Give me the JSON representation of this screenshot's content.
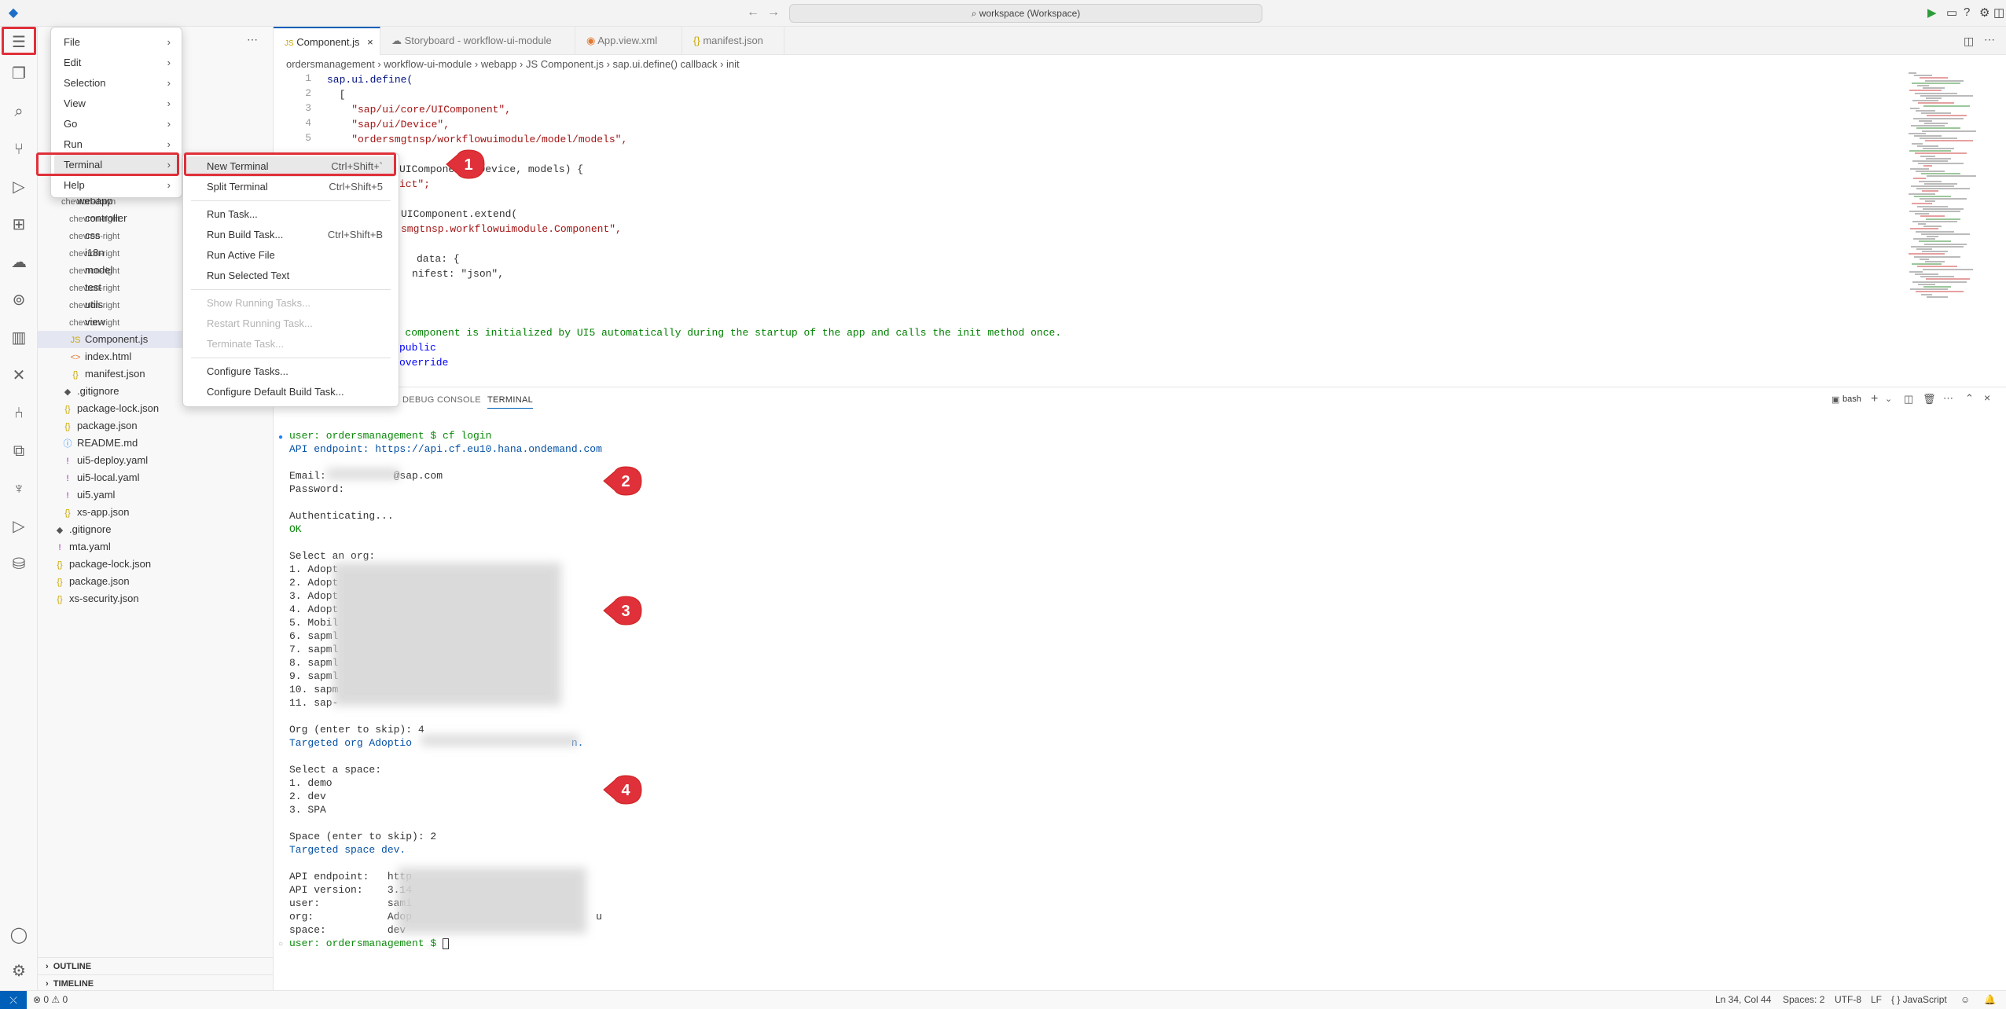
{
  "titlebar": {
    "command_center": "workspace (Workspace)",
    "back_icon": "arrow-left-icon",
    "forward_icon": "arrow-right-icon"
  },
  "activity_icons": [
    "menu-icon",
    "explorer-icon",
    "search-icon",
    "source-control-icon",
    "run-debug-icon",
    "extensions-icon",
    "cloud-icon",
    "git-graph-icon",
    "library-icon",
    "tools-icon",
    "branch-icon",
    "code-icon",
    "tree-icon",
    "play-icon",
    "database-icon",
    "account-icon",
    "settings-icon"
  ],
  "tabs": [
    {
      "label": "Component.js",
      "active": true,
      "icon": "js-icon"
    },
    {
      "label": "Storyboard - workflow-ui-module",
      "active": false,
      "icon": "storyboard-icon"
    },
    {
      "label": "App.view.xml",
      "active": false,
      "icon": "rss-icon"
    },
    {
      "label": "manifest.json",
      "active": false,
      "icon": "json-icon"
    }
  ],
  "breadcrumb": [
    "ordersmanagement",
    "workflow-ui-module",
    "webapp",
    "JS Component.js",
    "sap.ui.define() callback",
    "init"
  ],
  "explorer": {
    "items": [
      {
        "label": "webapp",
        "indent": 1,
        "icon": "chevron-down"
      },
      {
        "label": "controller",
        "indent": 2,
        "icon": "chevron-right"
      },
      {
        "label": "css",
        "indent": 2,
        "icon": "chevron-right"
      },
      {
        "label": "i18n",
        "indent": 2,
        "icon": "chevron-right"
      },
      {
        "label": "model",
        "indent": 2,
        "icon": "chevron-right"
      },
      {
        "label": "test",
        "indent": 2,
        "icon": "chevron-right"
      },
      {
        "label": "utils",
        "indent": 2,
        "icon": "chevron-right"
      },
      {
        "label": "view",
        "indent": 2,
        "icon": "chevron-right"
      },
      {
        "label": "Component.js",
        "indent": 2,
        "icon": "JS",
        "selected": true
      },
      {
        "label": "index.html",
        "indent": 2,
        "icon": "<>"
      },
      {
        "label": "manifest.json",
        "indent": 2,
        "icon": "{}"
      },
      {
        "label": ".gitignore",
        "indent": 1,
        "icon": "◆"
      },
      {
        "label": "package-lock.json",
        "indent": 1,
        "icon": "{}"
      },
      {
        "label": "package.json",
        "indent": 1,
        "icon": "{}"
      },
      {
        "label": "README.md",
        "indent": 1,
        "icon": "ⓘ"
      },
      {
        "label": "ui5-deploy.yaml",
        "indent": 1,
        "icon": "!"
      },
      {
        "label": "ui5-local.yaml",
        "indent": 1,
        "icon": "!"
      },
      {
        "label": "ui5.yaml",
        "indent": 1,
        "icon": "!"
      },
      {
        "label": "xs-app.json",
        "indent": 1,
        "icon": "{}"
      },
      {
        "label": ".gitignore",
        "indent": 0,
        "icon": "◆"
      },
      {
        "label": "mta.yaml",
        "indent": 0,
        "icon": "!"
      },
      {
        "label": "package-lock.json",
        "indent": 0,
        "icon": "{}"
      },
      {
        "label": "package.json",
        "indent": 0,
        "icon": "{}"
      },
      {
        "label": "xs-security.json",
        "indent": 0,
        "icon": "{}"
      }
    ],
    "outline_label": "OUTLINE",
    "timeline_label": "TIMELINE"
  },
  "editor": {
    "lines": [
      {
        "n": "1",
        "text": "sap.ui.define(",
        "cls": ""
      },
      {
        "n": "2",
        "text": "  [",
        "cls": ""
      },
      {
        "n": "3",
        "text": "    \"sap/ui/core/UIComponent\",",
        "cls": "str"
      },
      {
        "n": "4",
        "text": "    \"sap/ui/Device\",",
        "cls": "str"
      },
      {
        "n": "5",
        "text": "    \"ordersmgtnsp/workflowuimodule/model/models\",",
        "cls": "str"
      }
    ],
    "fragments": [
      {
        "text": "UIComponent, Device, models) {",
        "cls": ""
      },
      {
        "text": "ict\";",
        "cls": "str"
      },
      {
        "text": "UIComponent.extend(",
        "cls": ""
      },
      {
        "text": "smgtnsp.workflowuimodule.Component\",",
        "cls": "str"
      },
      {
        "text": "data: {",
        "cls": ""
      },
      {
        "text": "nifest: \"json\",",
        "cls": ""
      },
      {
        "text": "he component is initialized by UI5 automatically during the startup of the app and calls the init method once.",
        "cls": "cm"
      },
      {
        "text": "public",
        "cls": "kw"
      },
      {
        "text": "override",
        "cls": "kw"
      }
    ]
  },
  "panel": {
    "tabs": [
      "DEBUG CONSOLE",
      "TERMINAL"
    ],
    "shell_label": "bash"
  },
  "terminal": {
    "lines": [
      {
        "text": "user: ordersmanagement $ cf login",
        "kind": "prompt"
      },
      {
        "text": "API endpoint: https://api.cf.eu10.hana.ondemand.com",
        "kind": "endpoint"
      },
      {
        "text": "",
        "kind": ""
      },
      {
        "text": "Email:           @sap.com",
        "kind": ""
      },
      {
        "text": "Password:",
        "kind": ""
      },
      {
        "text": "",
        "kind": ""
      },
      {
        "text": "Authenticating...",
        "kind": ""
      },
      {
        "text": "OK",
        "kind": "ok"
      },
      {
        "text": "",
        "kind": ""
      },
      {
        "text": "Select an org:",
        "kind": ""
      },
      {
        "text": "1. Adopt",
        "kind": ""
      },
      {
        "text": "2. Adopt",
        "kind": ""
      },
      {
        "text": "3. Adopt",
        "kind": ""
      },
      {
        "text": "4. Adopt",
        "kind": ""
      },
      {
        "text": "5. Mobil",
        "kind": ""
      },
      {
        "text": "6. sapml",
        "kind": ""
      },
      {
        "text": "7. sapml",
        "kind": ""
      },
      {
        "text": "8. sapml",
        "kind": ""
      },
      {
        "text": "9. sapml",
        "kind": ""
      },
      {
        "text": "10. sapm",
        "kind": ""
      },
      {
        "text": "11. sap-",
        "kind": ""
      },
      {
        "text": "",
        "kind": ""
      },
      {
        "text": "Org (enter to skip): 4",
        "kind": ""
      },
      {
        "text": "Targeted org Adoptio                          n.",
        "kind": "targeted"
      },
      {
        "text": "",
        "kind": ""
      },
      {
        "text": "Select a space:",
        "kind": ""
      },
      {
        "text": "1. demo",
        "kind": ""
      },
      {
        "text": "2. dev",
        "kind": ""
      },
      {
        "text": "3. SPA",
        "kind": ""
      },
      {
        "text": "",
        "kind": ""
      },
      {
        "text": "Space (enter to skip): 2",
        "kind": ""
      },
      {
        "text": "Targeted space dev.",
        "kind": "targeted"
      },
      {
        "text": "",
        "kind": ""
      },
      {
        "text": "API endpoint:   http",
        "kind": ""
      },
      {
        "text": "API version:    3.14",
        "kind": ""
      },
      {
        "text": "user:           sami",
        "kind": ""
      },
      {
        "text": "org:            Adop                              u",
        "kind": ""
      },
      {
        "text": "space:          dev",
        "kind": ""
      },
      {
        "text": "user: ordersmanagement $ ",
        "kind": "prompt-end"
      }
    ]
  },
  "main_menu": {
    "items": [
      {
        "label": "File"
      },
      {
        "label": "Edit"
      },
      {
        "label": "Selection"
      },
      {
        "label": "View"
      },
      {
        "label": "Go"
      },
      {
        "label": "Run"
      },
      {
        "label": "Terminal",
        "highlight": true
      },
      {
        "label": "Help"
      }
    ]
  },
  "terminal_menu": {
    "groups": [
      [
        {
          "label": "New Terminal",
          "shortcut": "Ctrl+Shift+`",
          "highlight": true
        },
        {
          "label": "Split Terminal",
          "shortcut": "Ctrl+Shift+5"
        }
      ],
      [
        {
          "label": "Run Task..."
        },
        {
          "label": "Run Build Task...",
          "shortcut": "Ctrl+Shift+B"
        },
        {
          "label": "Run Active File"
        },
        {
          "label": "Run Selected Text"
        }
      ],
      [
        {
          "label": "Show Running Tasks...",
          "disabled": true
        },
        {
          "label": "Restart Running Task...",
          "disabled": true
        },
        {
          "label": "Terminate Task...",
          "disabled": true
        }
      ],
      [
        {
          "label": "Configure Tasks..."
        },
        {
          "label": "Configure Default Build Task..."
        }
      ]
    ]
  },
  "callouts": [
    "1",
    "2",
    "3",
    "4"
  ],
  "statusbar": {
    "problems": "⊗ 0  ⚠ 0",
    "position": "Ln 34, Col 44",
    "spaces": "Spaces: 2",
    "encoding": "UTF-8",
    "eol": "LF",
    "language": "{ } JavaScript"
  },
  "colors": {
    "accent": "#005fb8",
    "highlight_border": "#e0303a",
    "callout": "#e0303a"
  }
}
